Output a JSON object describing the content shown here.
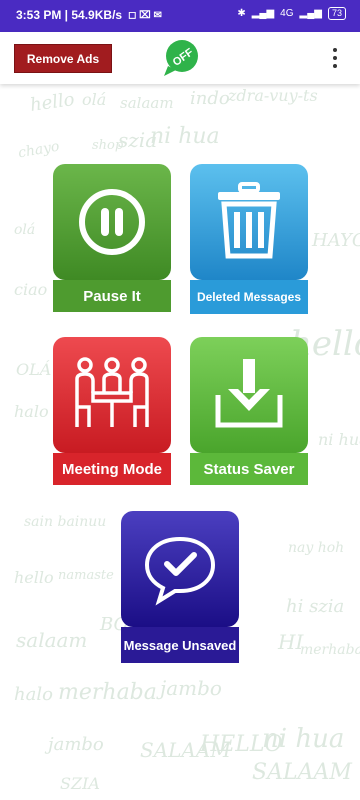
{
  "status_bar": {
    "time_speed": "3:53 PM | 54.9KB/s",
    "signal_tag": "4G",
    "battery": "73"
  },
  "app_bar": {
    "remove_ads_label": "Remove Ads",
    "toggle_label": "OFF"
  },
  "tiles": [
    {
      "label": "Pause It",
      "icon": "pause-icon",
      "color": "#4e9b2f"
    },
    {
      "label": "Deleted Messages",
      "icon": "trash-icon",
      "color": "#2a9bd9"
    },
    {
      "label": "Meeting Mode",
      "icon": "meeting-icon",
      "color": "#d8242b"
    },
    {
      "label": "Status Saver",
      "icon": "download-icon",
      "color": "#5cb83a"
    },
    {
      "label": "Message Unsaved",
      "icon": "message-check-icon",
      "color": "#2a1a96"
    }
  ],
  "background_words": [
    "hello",
    "olá",
    "salaam",
    "indo",
    "zdra-vuy-ts",
    "chayo",
    "shop",
    "szia",
    "ni hua",
    "ciao",
    "olá",
    "HAYO",
    "OLÁ",
    "hello",
    "halo",
    "ni hua",
    "sain bainuu",
    "hello",
    "hi szia",
    "BO",
    "salaam",
    "HI",
    "merhaba",
    "halo",
    "merhaba",
    "jambo",
    "jambo",
    "SALAAM",
    "HELLO",
    "ni hua",
    "SZIA",
    "SALAAM",
    "nay hoh",
    "namaste"
  ]
}
